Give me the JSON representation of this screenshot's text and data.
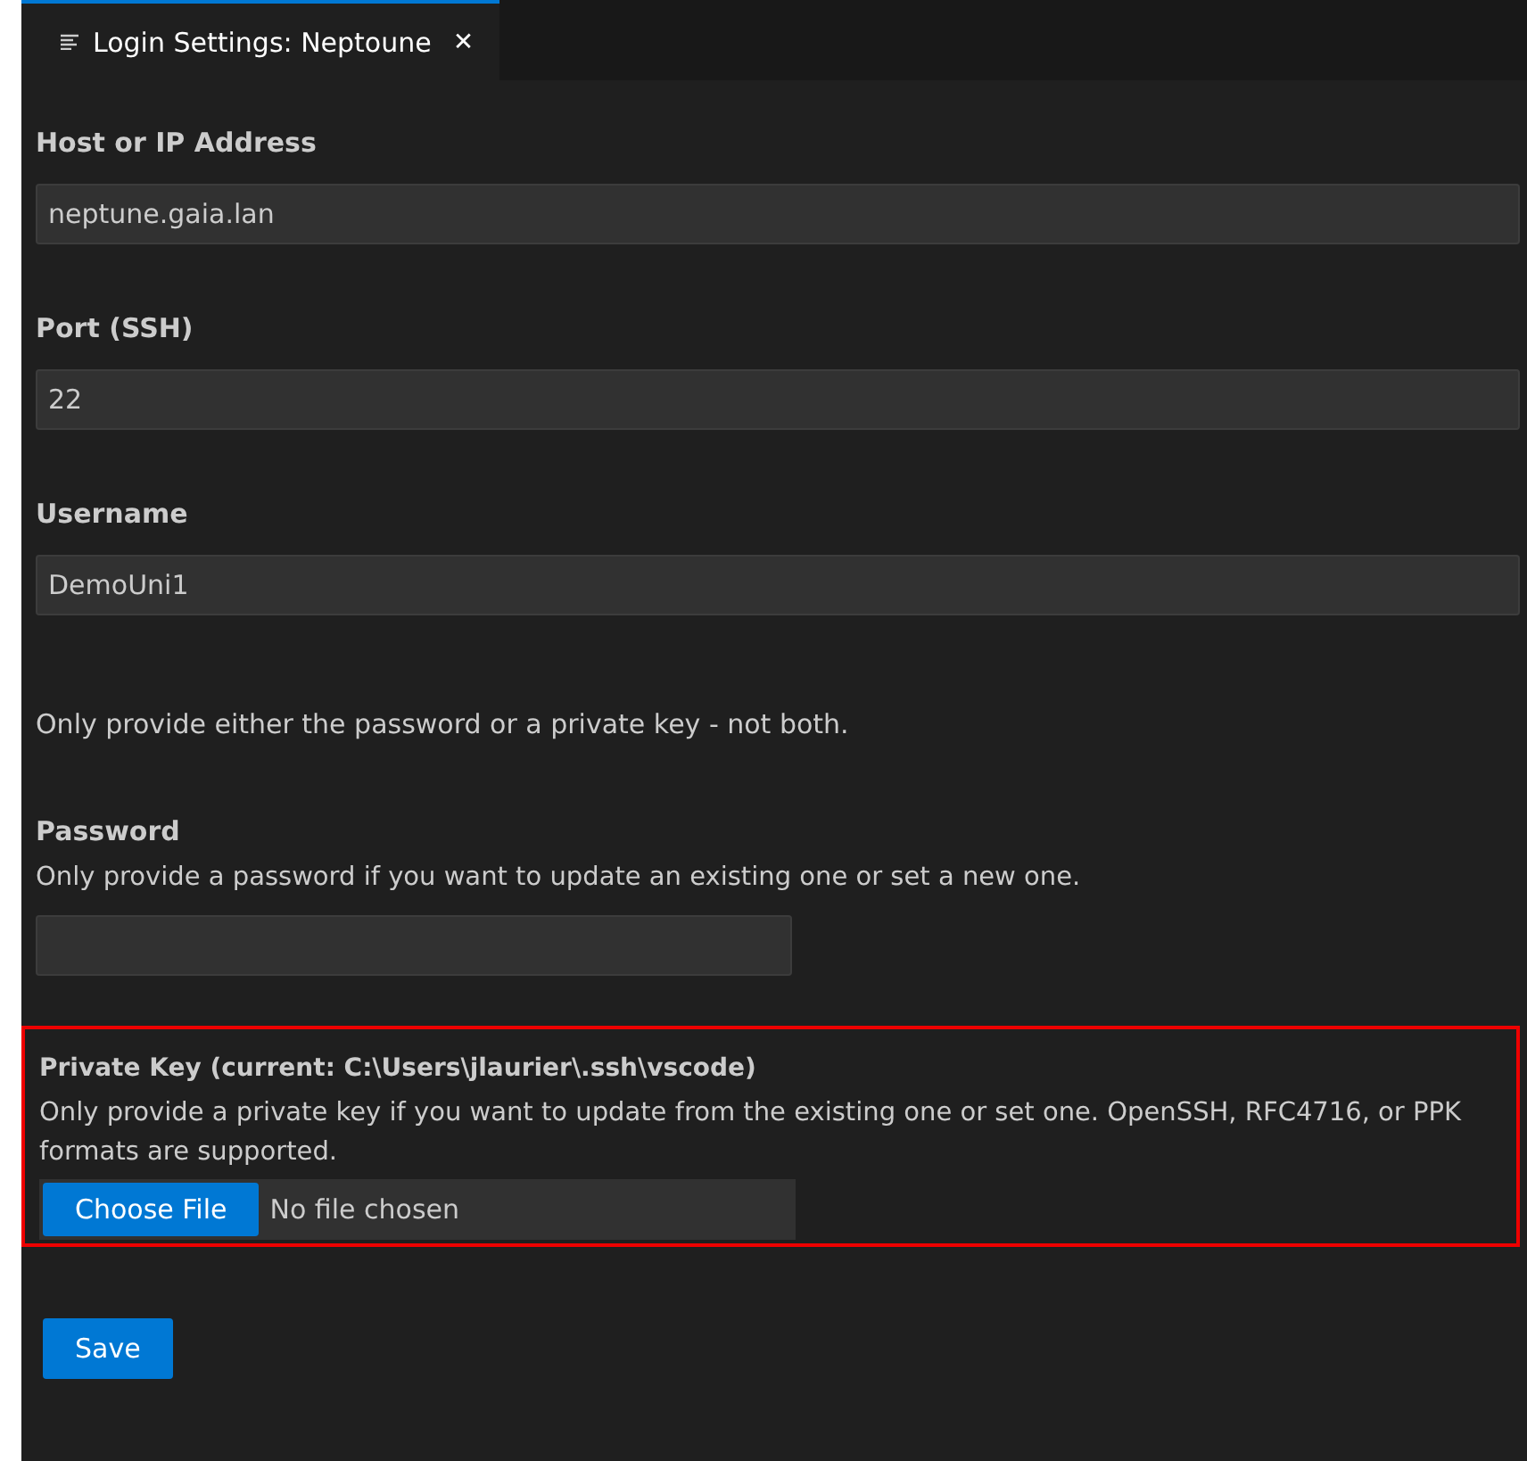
{
  "tab": {
    "title": "Login Settings: Neptoune",
    "close": "✕",
    "selected": true
  },
  "fields": [
    {
      "label": "Host or IP Address",
      "value": "neptune.gaia.lan"
    },
    {
      "label": "Port (SSH)",
      "value": "22"
    },
    {
      "label": "Username",
      "value": "DemoUni1"
    }
  ],
  "note": "Only provide either the password or a private key - not both.",
  "password": {
    "label": "Password",
    "help": "Only provide a password if you want to update an existing one or set a new one."
  },
  "private_key": {
    "label": "Private Key (current: C:\\Users\\jlaurier\\.ssh\\vscode)",
    "help": "Only provide a private key if you want to update from the existing one or set one. OpenSSH, RFC4716, or PPK formats are supported.",
    "button": "Choose File",
    "status": "No file chosen",
    "highlighted": true
  },
  "save": "Save"
}
